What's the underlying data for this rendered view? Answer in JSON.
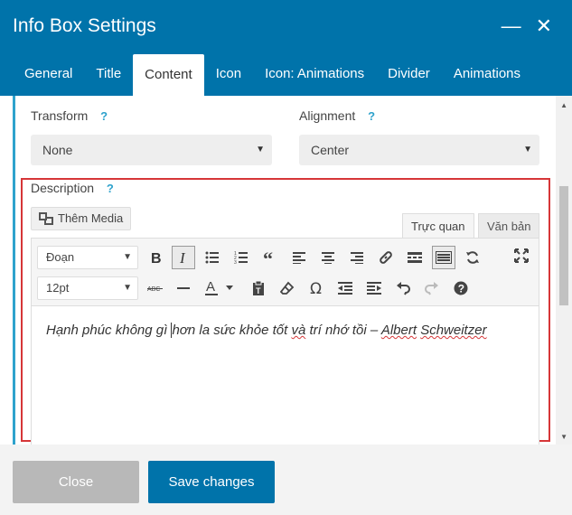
{
  "dialog": {
    "title": "Info Box Settings",
    "minimize_glyph": "—",
    "close_glyph": "✕"
  },
  "tabs": [
    {
      "label": "General"
    },
    {
      "label": "Title"
    },
    {
      "label": "Content",
      "active": true
    },
    {
      "label": "Icon"
    },
    {
      "label": "Icon: Animations"
    },
    {
      "label": "Divider"
    },
    {
      "label": "Animations"
    }
  ],
  "fields": {
    "transform": {
      "label": "Transform",
      "help": "?",
      "value": "None"
    },
    "alignment": {
      "label": "Alignment",
      "help": "?",
      "value": "Center"
    },
    "description": {
      "label": "Description",
      "help": "?"
    }
  },
  "editor": {
    "add_media_label": "Thêm Media",
    "visual_tab": "Trực quan",
    "text_tab": "Văn bản",
    "format_select": "Đoạn",
    "size_select": "12pt",
    "content_parts": {
      "p1": "Hạnh phúc không gì ",
      "p2": "hơn",
      "p3": " la sức khỏe tốt ",
      "p4": "và",
      "p5": " trí nhớ tồi – ",
      "p6": "Albert",
      "p7": " ",
      "p8": "Schweitzer"
    }
  },
  "footer": {
    "close_label": "Close",
    "save_label": "Save changes"
  },
  "colors": {
    "header": "#0073aa",
    "accent": "#2ea2cc",
    "highlight_border": "#d63638"
  }
}
